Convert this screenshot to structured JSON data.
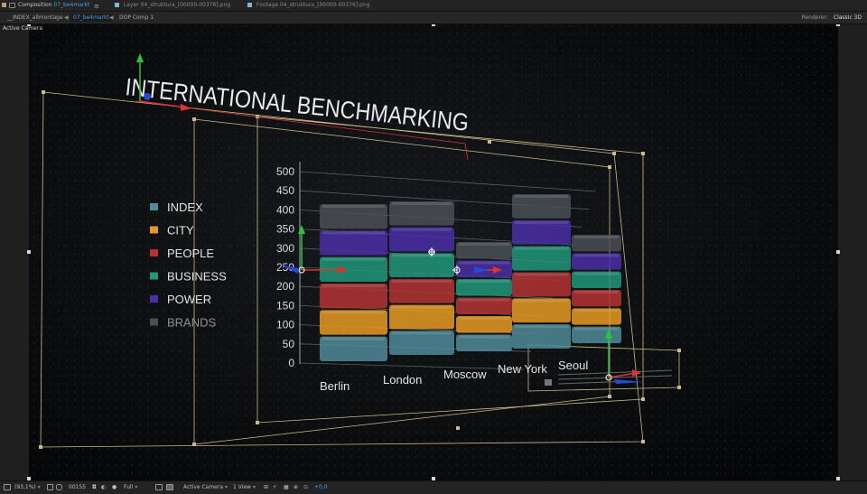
{
  "tabs": {
    "composition_label": "Composition",
    "composition_name": "07_be4markt",
    "layer_label": "Layer",
    "layer_name": "04_struktura_[00000-00376].png",
    "footage_label": "Footage",
    "footage_name": "04_struktura_[00000-00376].png"
  },
  "breadcrumbs": [
    "__INDEX_allmontage",
    "07_be4markt",
    "DOP Comp 1"
  ],
  "renderer": {
    "label": "Renderer:",
    "value": "Classic 3D"
  },
  "viewer": {
    "camera_label": "Active Camera"
  },
  "scene": {
    "title": "INTERNATIONAL BENCHMARKING",
    "legend": [
      {
        "label": "INDEX",
        "color": "#4f8b98"
      },
      {
        "label": "CITY",
        "color": "#e69a22"
      },
      {
        "label": "PEOPLE",
        "color": "#b43232"
      },
      {
        "label": "BUSINESS",
        "color": "#21967a"
      },
      {
        "label": "POWER",
        "color": "#4a2fa4"
      },
      {
        "label": "BRANDS",
        "color": "#4a4f55"
      }
    ],
    "y_ticks": [
      "500",
      "450",
      "400",
      "350",
      "300",
      "250",
      "200",
      "150",
      "100",
      "50",
      "0"
    ],
    "cities": [
      "Berlin",
      "London",
      "Moscow",
      "New York",
      "Seoul"
    ]
  },
  "bottombar": {
    "zoom": "(93,1%)",
    "timecode": "00155",
    "resolution": "Full",
    "view_camera": "Active Camera",
    "view_count": "1 View",
    "exposure": "+0,0"
  }
}
